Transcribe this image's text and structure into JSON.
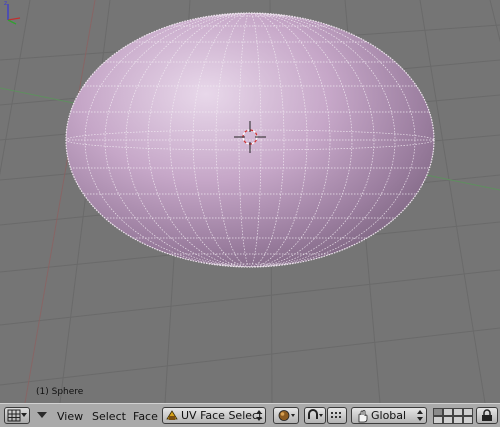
{
  "viewport": {
    "object_label": "(1) Sphere",
    "mesh_color": "#c8a8c8",
    "background_color": "#757575"
  },
  "header": {
    "menus": [
      "View",
      "Select",
      "Face"
    ],
    "mode_select": "UV Face Select",
    "orientation_select": "Global",
    "header_color": "#aaaaaa"
  },
  "icons": {
    "window_type": "grid-icon",
    "mode": "uv-face-select-icon",
    "shading": "solid-sphere-icon",
    "pivot": "pivot-icon",
    "snap": "snap-magnet-icon",
    "orientation": "hand-icon",
    "layers": "layers-grid",
    "lock": "lock-icon"
  }
}
